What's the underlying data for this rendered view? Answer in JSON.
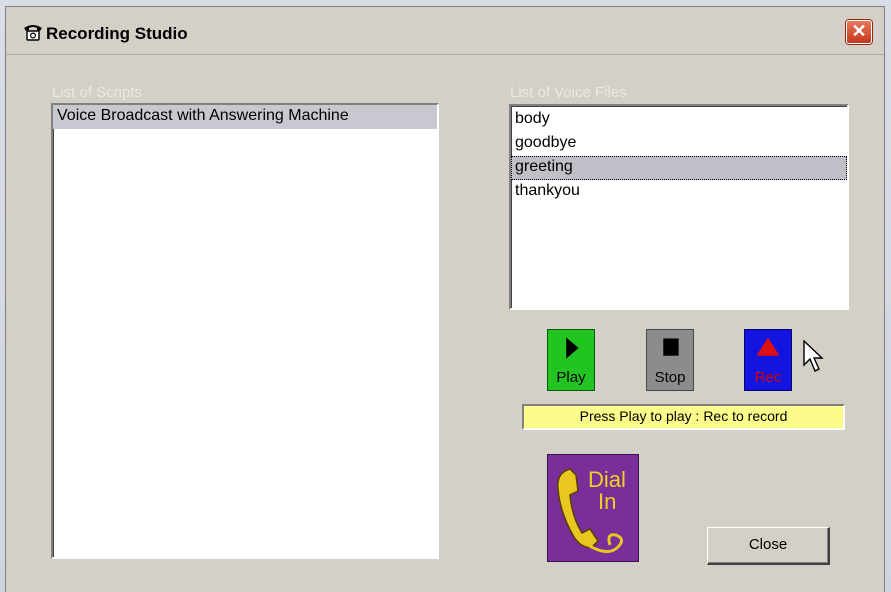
{
  "window": {
    "title": "Recording Studio",
    "close_glyph": "✕"
  },
  "scripts": {
    "label": "List of Scripts",
    "items": [
      "Voice Broadcast with Answering Machine"
    ],
    "selected_index": 0
  },
  "voice_files": {
    "label": "List of Voice Files",
    "items": [
      "body",
      "goodbye",
      "greeting",
      "thankyou"
    ],
    "selected_index": 2
  },
  "controls": {
    "play_label": "Play",
    "stop_label": "Stop",
    "rec_label": "Rec"
  },
  "status_text": "Press Play to play : Rec to record",
  "dial_in": {
    "line1": "Dial",
    "line2": "In"
  },
  "close_label": "Close",
  "icons": {
    "title": "telephone-icon",
    "play": "play-triangle-icon",
    "stop": "stop-square-icon",
    "rec": "record-triangle-icon",
    "dial_in": "telephone-handset-icon"
  },
  "colors": {
    "play_bg": "#22c422",
    "stop_bg": "#8c8c8c",
    "rec_bg": "#1414e0",
    "rec_text": "#d00000",
    "status_bg": "#fcfc8a",
    "dial_in_bg": "#7a2e9a",
    "dial_in_text": "#f0d020"
  }
}
